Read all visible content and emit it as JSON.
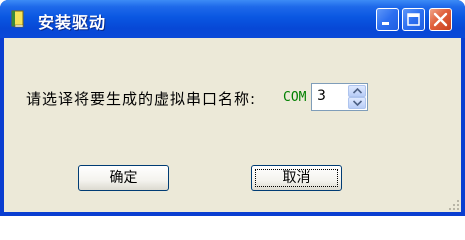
{
  "window": {
    "title": "安装驱动",
    "icon": "book-icon"
  },
  "titlebar_buttons": {
    "minimize": "minimize-icon",
    "maximize": "maximize-icon",
    "close": "close-icon"
  },
  "form": {
    "prompt": "请选译将要生成的虚拟串口名称:",
    "com_label": "COM",
    "port_value": "3"
  },
  "buttons": {
    "ok": "确定",
    "cancel": "取消"
  },
  "colors": {
    "titlebar": "#0a57e2",
    "client_bg": "#ece9d8",
    "com_label": "#008000",
    "close_button": "#e0603c"
  }
}
